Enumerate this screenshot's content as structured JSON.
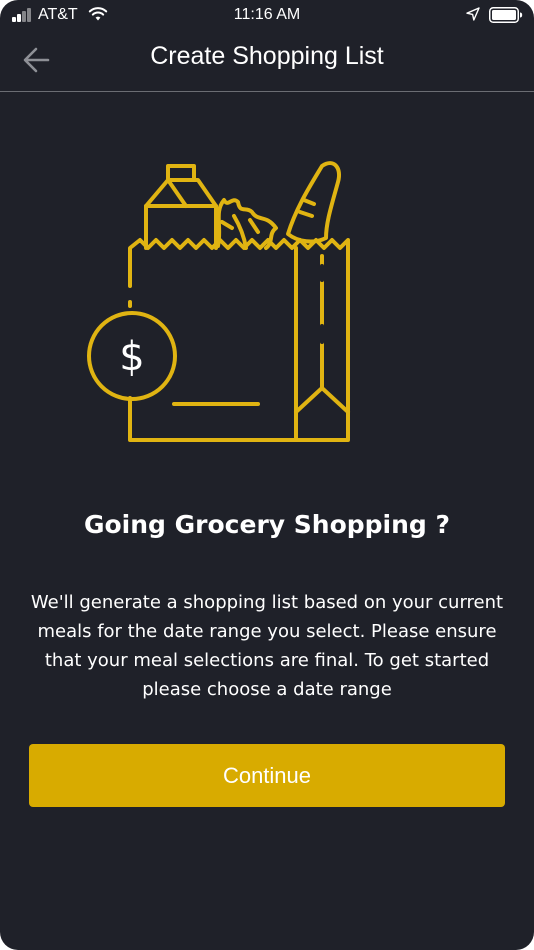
{
  "status_bar": {
    "carrier": "AT&T",
    "time": "11:16 AM",
    "icons": [
      "signal-icon",
      "wifi-icon",
      "location-icon",
      "battery-icon"
    ]
  },
  "nav": {
    "title": "Create Shopping List",
    "back_icon": "back-arrow-icon"
  },
  "illustration": {
    "icon": "grocery-bag-icon",
    "currency_symbol": "$"
  },
  "content": {
    "headline": "Going Grocery Shopping ?",
    "description": "We'll generate a shopping list based on your current meals for the date range you select. Please ensure that your meal selections are final. To get started please choose a date range"
  },
  "actions": {
    "continue_label": "Continue"
  },
  "colors": {
    "background": "#1f2129",
    "accent": "#d8ab00",
    "illustration_stroke": "#e0b412",
    "text": "#ffffff",
    "divider": "#6b6d73"
  }
}
